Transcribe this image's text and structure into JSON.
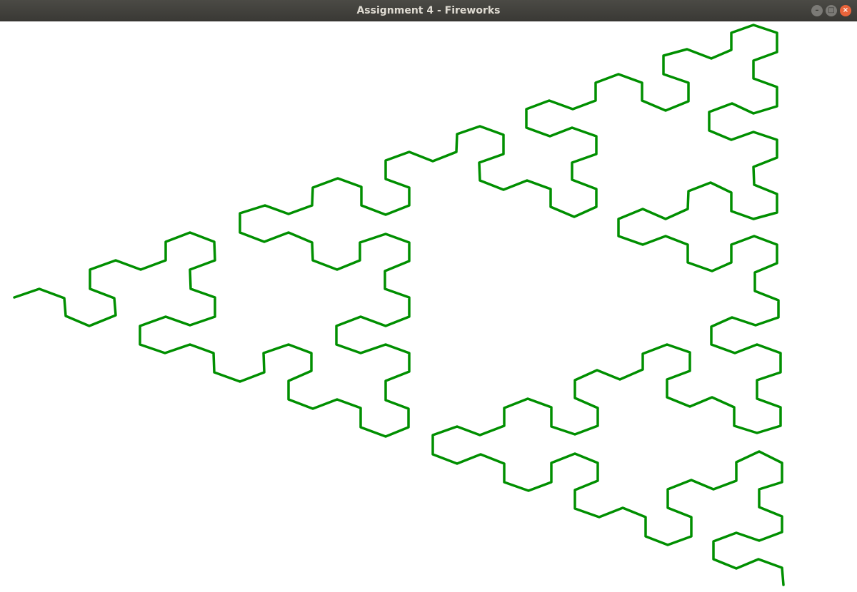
{
  "window": {
    "title": "Assignment 4 - Fireworks",
    "controls": {
      "minimize_icon": "minimize-icon",
      "maximize_icon": "maximize-icon",
      "close_icon": "close-icon",
      "close_color": "#e9643b"
    }
  },
  "canvas": {
    "background": "#ffffff",
    "curve": {
      "shape": "Koch-style fractal curve",
      "color": "#008f00"
    }
  }
}
